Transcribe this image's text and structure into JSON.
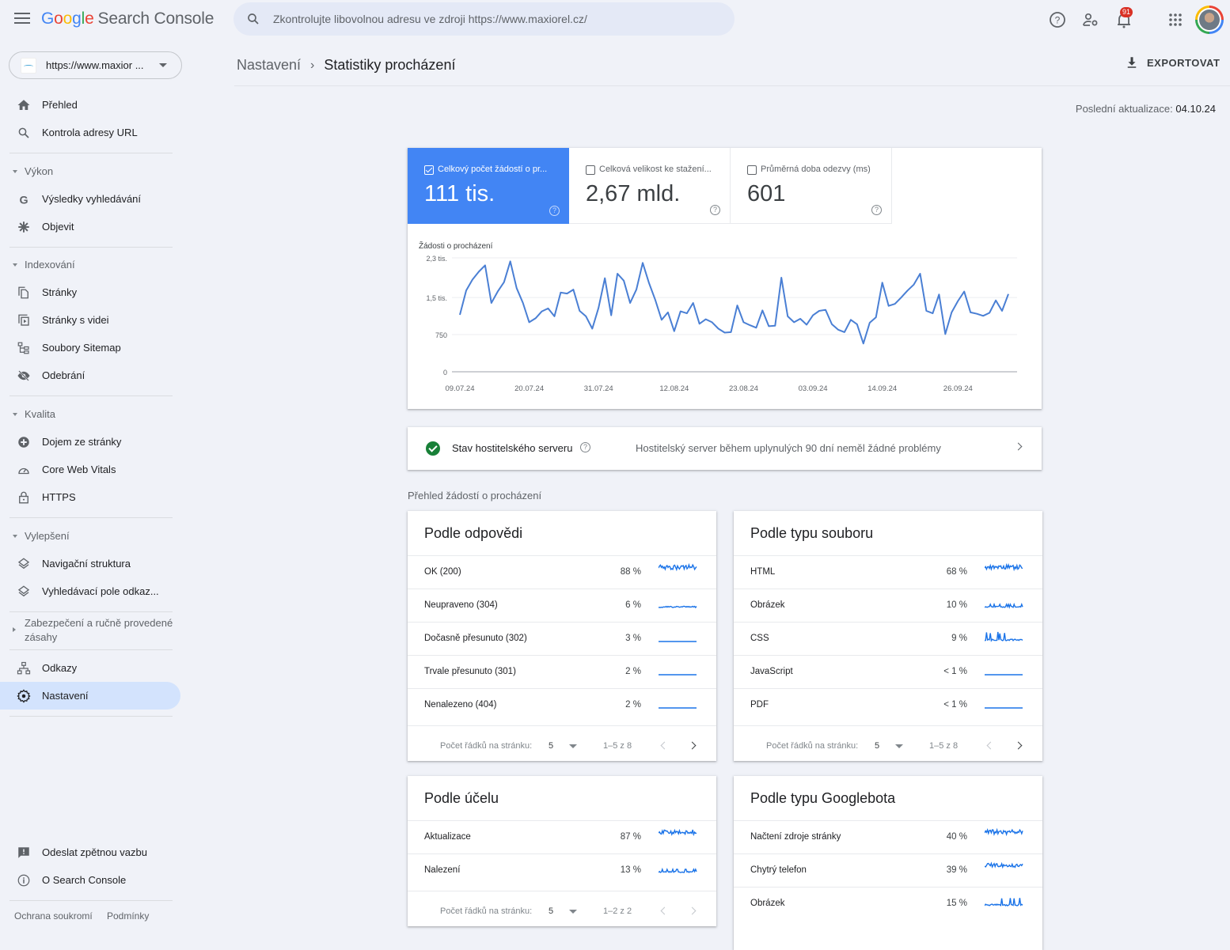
{
  "app": {
    "logo_google": [
      "G",
      "o",
      "o",
      "g",
      "l",
      "e"
    ],
    "logo_product": "Search Console"
  },
  "search": {
    "placeholder": "Zkontrolujte libovolnou adresu ve zdroji https://www.maxiorel.cz/"
  },
  "header": {
    "notification_count": "91",
    "export_label": "EXPORTOVAT"
  },
  "property": {
    "url": "https://www.maxior ..."
  },
  "breadcrumb": {
    "parent": "Nastavení",
    "current": "Statistiky procházení"
  },
  "last_updated": {
    "label": "Poslední aktualizace:",
    "value": "04.10.24"
  },
  "sidebar": {
    "items": [
      {
        "label": "Přehled",
        "icon": "home-icon"
      },
      {
        "label": "Kontrola adresy URL",
        "icon": "search-icon"
      }
    ],
    "sections": [
      {
        "label": "Výkon",
        "expanded": true,
        "items": [
          {
            "label": "Výsledky vyhledávání",
            "icon": "google-g-icon"
          },
          {
            "label": "Objevit",
            "icon": "asterisk-icon"
          }
        ]
      },
      {
        "label": "Indexování",
        "expanded": true,
        "items": [
          {
            "label": "Stránky",
            "icon": "pages-icon"
          },
          {
            "label": "Stránky s videi",
            "icon": "video-pages-icon"
          },
          {
            "label": "Soubory Sitemap",
            "icon": "sitemap-icon"
          },
          {
            "label": "Odebrání",
            "icon": "eye-off-icon"
          }
        ]
      },
      {
        "label": "Kvalita",
        "expanded": true,
        "items": [
          {
            "label": "Dojem ze stránky",
            "icon": "page-experience-icon"
          },
          {
            "label": "Core Web Vitals",
            "icon": "gauge-icon"
          },
          {
            "label": "HTTPS",
            "icon": "lock-icon"
          }
        ]
      },
      {
        "label": "Vylepšení",
        "expanded": true,
        "items": [
          {
            "label": "Navigační struktura",
            "icon": "layers-icon"
          },
          {
            "label": "Vyhledávací pole odkaz...",
            "icon": "layers-icon"
          }
        ]
      },
      {
        "label": "Zabezpečení a ručně provedené zásahy",
        "expanded": false,
        "items": []
      }
    ],
    "bottom_items": [
      {
        "label": "Odkazy",
        "icon": "links-icon"
      },
      {
        "label": "Nastavení",
        "icon": "gear-icon",
        "active": true
      }
    ],
    "footer_items": [
      {
        "label": "Odeslat zpětnou vazbu",
        "icon": "feedback-icon"
      },
      {
        "label": "O Search Console",
        "icon": "info-icon"
      }
    ],
    "footer_links": [
      "Ochrana soukromí",
      "Podmínky"
    ]
  },
  "metrics": [
    {
      "label": "Celkový počet žádostí o pr...",
      "value": "111 tis.",
      "checked": true
    },
    {
      "label": "Celková velikost ke stažení...",
      "value": "2,67 mld.",
      "checked": false
    },
    {
      "label": "Průměrná doba odezvy (ms)",
      "value": "601",
      "checked": false
    }
  ],
  "host_status": {
    "title": "Stav hostitelského serveru",
    "description": "Hostitelský server během uplynulých 90 dní neměl žádné problémy"
  },
  "overview_title": "Přehled žádostí o procházení",
  "tables": [
    {
      "title": "Podle odpovědi",
      "rows": [
        {
          "name": "OK (200)",
          "pct": "88 %",
          "spark": "high"
        },
        {
          "name": "Neupraveno (304)",
          "pct": "6 %",
          "spark": "low"
        },
        {
          "name": "Dočasně přesunuto (302)",
          "pct": "3 %",
          "spark": "flat"
        },
        {
          "name": "Trvale přesunuto (301)",
          "pct": "2 %",
          "spark": "flat"
        },
        {
          "name": "Nenalezeno (404)",
          "pct": "2 %",
          "spark": "flat"
        }
      ],
      "rows_per_page_label": "Počet řádků na stránku:",
      "rows_per_page": "5",
      "range": "1–5 z 8"
    },
    {
      "title": "Podle typu souboru",
      "rows": [
        {
          "name": "HTML",
          "pct": "68 %",
          "spark": "high"
        },
        {
          "name": "Obrázek",
          "pct": "10 %",
          "spark": "low"
        },
        {
          "name": "CSS",
          "pct": "9 %",
          "spark": "spiky"
        },
        {
          "name": "JavaScript",
          "pct": "< 1 %",
          "spark": "flat"
        },
        {
          "name": "PDF",
          "pct": "< 1 %",
          "spark": "flat"
        }
      ],
      "rows_per_page_label": "Počet řádků na stránku:",
      "rows_per_page": "5",
      "range": "1–5 z 8"
    },
    {
      "title": "Podle účelu",
      "rows": [
        {
          "name": "Aktualizace",
          "pct": "87 %",
          "spark": "high"
        },
        {
          "name": "Nalezení",
          "pct": "13 %",
          "spark": "low"
        }
      ],
      "rows_per_page_label": "Počet řádků na stránku:",
      "rows_per_page": "5",
      "range": "1–2 z 2"
    },
    {
      "title": "Podle typu Googlebota",
      "rows": [
        {
          "name": "Načtení zdroje stránky",
          "pct": "40 %",
          "spark": "high"
        },
        {
          "name": "Chytrý telefon",
          "pct": "39 %",
          "spark": "high"
        },
        {
          "name": "Obrázek",
          "pct": "15 %",
          "spark": "spiky"
        }
      ]
    }
  ],
  "chart_data": {
    "type": "line",
    "title": "Žádosti o procházení",
    "series": [
      {
        "name": "Celkový počet žádostí o procházení",
        "color": "#4a7fd4",
        "values": [
          1150,
          1640,
          1860,
          2020,
          2150,
          1390,
          1620,
          1810,
          2230,
          1690,
          1390,
          1000,
          1080,
          1220,
          1280,
          1120,
          1600,
          1580,
          1660,
          1230,
          1120,
          870,
          1290,
          1890,
          1140,
          1980,
          1840,
          1390,
          1660,
          2200,
          1790,
          1450,
          1050,
          1200,
          820,
          1220,
          1180,
          1390,
          970,
          1060,
          1000,
          870,
          790,
          800,
          1340,
          1000,
          940,
          890,
          1240,
          920,
          930,
          1900,
          1120,
          1000,
          1070,
          950,
          1140,
          1230,
          1250,
          960,
          850,
          800,
          1050,
          960,
          570,
          990,
          1100,
          1800,
          1330,
          1370,
          1500,
          1640,
          1760,
          1980,
          1230,
          1180,
          1560,
          760,
          1200,
          1430,
          1620,
          1200,
          1170,
          1130,
          1190,
          1440,
          1230,
          1570
        ]
      }
    ],
    "x_ticks": [
      "09.07.24",
      "20.07.24",
      "31.07.24",
      "12.08.24",
      "23.08.24",
      "03.09.24",
      "14.09.24",
      "26.09.24"
    ],
    "y_ticks": [
      "0",
      "750",
      "1,5 tis.",
      "2,3 tis."
    ],
    "y_tick_values": [
      0,
      750,
      1500,
      2300
    ],
    "ylim": [
      0,
      2300
    ],
    "grid": true
  }
}
